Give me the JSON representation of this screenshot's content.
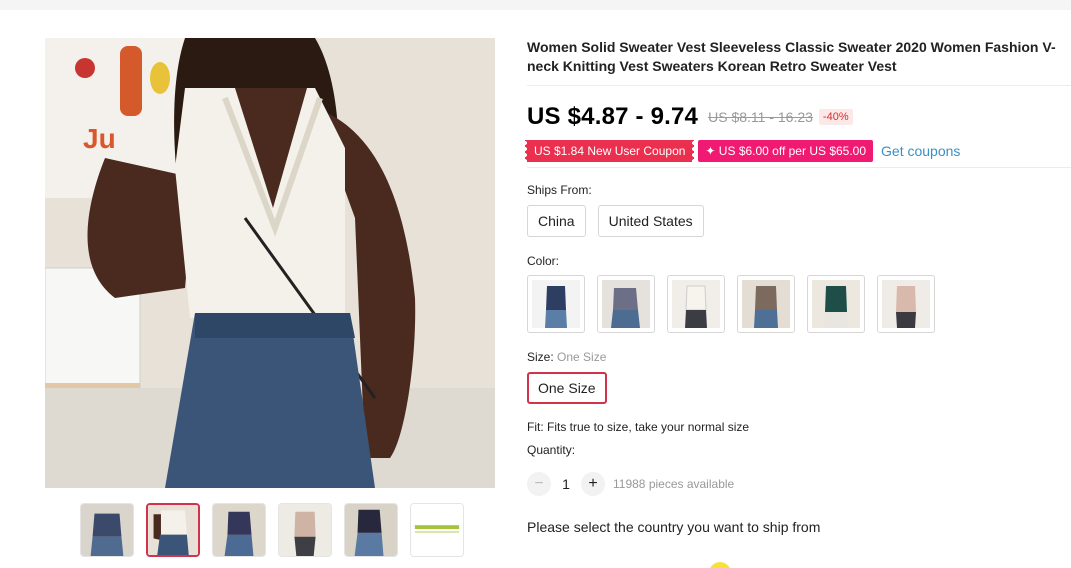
{
  "product": {
    "title": "Women Solid Sweater Vest Sleeveless Classic Sweater 2020 Women Fashion V-neck Knitting Vest Sweaters Korean Retro Sweater Vest",
    "price_range": "US $4.87 - 9.74",
    "original_price": "US $8.11 - 16.23",
    "discount": "-40%"
  },
  "coupons": {
    "new_user": "US $1.84 New User Coupon",
    "store_off": "✦ US $6.00 off per US $65.00",
    "get_link": "Get coupons"
  },
  "ships_from": {
    "label": "Ships From:",
    "options": [
      "China",
      "United States"
    ]
  },
  "color": {
    "label": "Color:",
    "swatch_icons": [
      "navy-vest-swatch",
      "grey-vest-swatch",
      "white-vest-swatch",
      "khaki-vest-swatch",
      "green-vest-swatch",
      "pink-vest-swatch"
    ]
  },
  "size": {
    "label": "Size:",
    "selected_label": "One Size",
    "options": [
      "One Size"
    ]
  },
  "fit": "Fit: Fits true to size, take your normal size",
  "quantity": {
    "label": "Quantity:",
    "minus": "−",
    "plus": "+",
    "value": "1",
    "available": "11988 pieces available"
  },
  "ship_prompt": "Please select the country you want to ship from",
  "colors": {
    "accent": "#d0344a",
    "coupon_red": "#eb2f4e",
    "coupon_pink": "#f01a73",
    "link_blue": "#3b8fc6"
  }
}
